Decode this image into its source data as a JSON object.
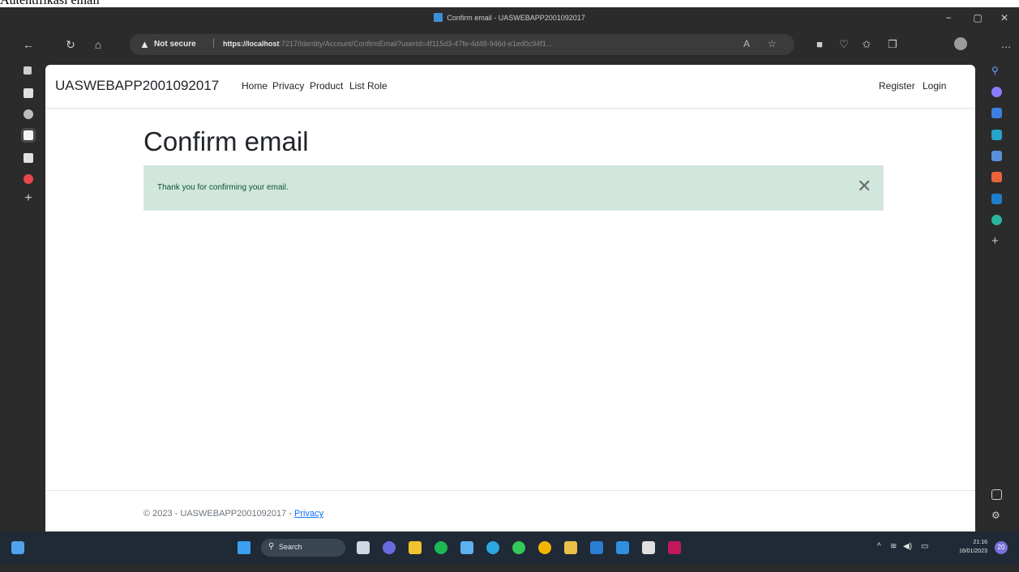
{
  "document_caption": "Autentifikasi email",
  "browser": {
    "window_title": "Confirm email - UASWEBAPP2001092017",
    "address": {
      "security_label": "Not secure",
      "url_host": "https://localhost",
      "url_rest": ":7217/Identity/Account/ConfirmEmail?userId=4f115d3-47fe-4d48-946d-e1ed0c94f1..."
    },
    "icons": [
      "back-icon",
      "refresh-icon",
      "home-icon",
      "warning-icon",
      "read-aloud-icon",
      "favorites-add-icon",
      "extensions-icon",
      "browser-essentials-icon",
      "favorites-icon",
      "collections-icon",
      "profile-icon",
      "more-icon"
    ]
  },
  "site": {
    "brand": "UASWEBAPP2001092017",
    "nav": [
      "Home",
      "Privacy",
      "Product",
      "List Role"
    ],
    "nav_right": [
      "Register",
      "Login"
    ],
    "page_title": "Confirm email",
    "alert_message": "Thank you for confirming your email.",
    "alert_color": "#d1e7dd",
    "footer_text": "© 2023 - UASWEBAPP2001092017 - ",
    "footer_link": "Privacy"
  },
  "taskbar": {
    "search_label": "Search",
    "time": "21:16",
    "date": "16/01/2023",
    "notification_count": "20"
  }
}
